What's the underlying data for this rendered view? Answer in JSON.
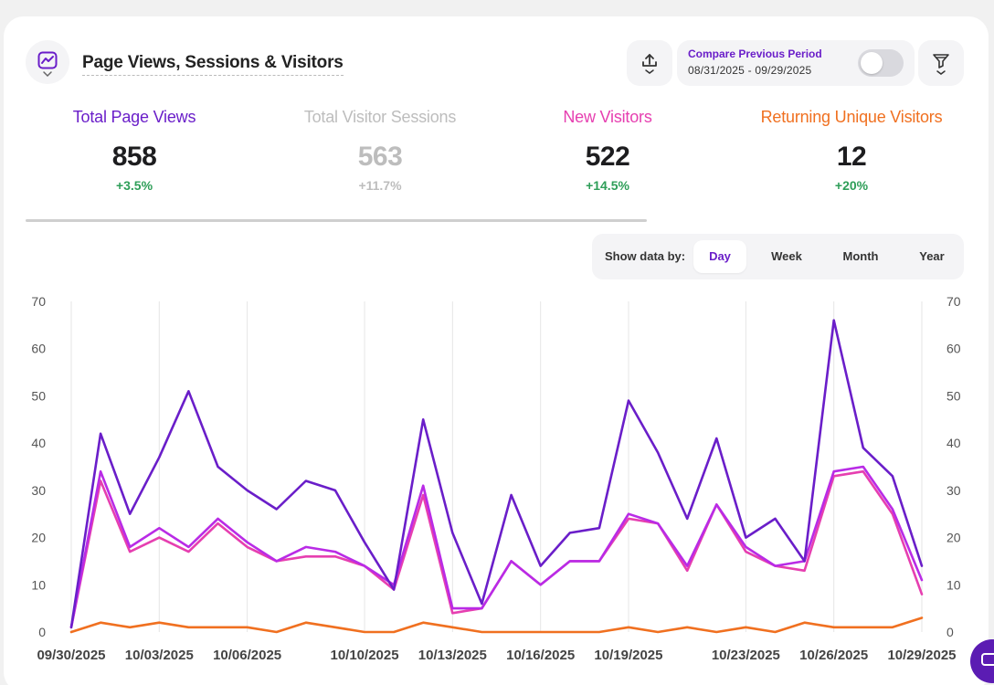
{
  "card": {
    "title": "Page Views, Sessions & Visitors",
    "icon": "chart-icon"
  },
  "compare": {
    "label": "Compare Previous Period",
    "range": "08/31/2025 - 09/29/2025",
    "enabled": false
  },
  "toolbar": {
    "export_icon": "upload-icon",
    "filter_icon": "filter-icon"
  },
  "metrics": [
    {
      "label": "Total Page Views",
      "value": "858",
      "change": "+3.5%",
      "color": "#6a1ec9"
    },
    {
      "label": "Total Visitor Sessions",
      "value": "563",
      "change": "+11.7%",
      "color": "#bdbdbd"
    },
    {
      "label": "New Visitors",
      "value": "522",
      "change": "+14.5%",
      "color": "#e63fb0"
    },
    {
      "label": "Returning Unique Visitors",
      "value": "12",
      "change": "+20%",
      "color": "#f07020"
    }
  ],
  "show_data": {
    "label": "Show data by:",
    "options": [
      "Day",
      "Week",
      "Month",
      "Year"
    ],
    "selected": "Day"
  },
  "colors": {
    "accent": "#6a1ec9",
    "positive": "#2e9e58"
  },
  "chart_data": {
    "type": "line",
    "x": [
      "09/30/2025",
      "10/01/2025",
      "10/02/2025",
      "10/03/2025",
      "10/04/2025",
      "10/05/2025",
      "10/06/2025",
      "10/07/2025",
      "10/08/2025",
      "10/09/2025",
      "10/10/2025",
      "10/11/2025",
      "10/12/2025",
      "10/13/2025",
      "10/14/2025",
      "10/15/2025",
      "10/16/2025",
      "10/17/2025",
      "10/18/2025",
      "10/19/2025",
      "10/20/2025",
      "10/21/2025",
      "10/22/2025",
      "10/23/2025",
      "10/24/2025",
      "10/25/2025",
      "10/26/2025",
      "10/27/2025",
      "10/28/2025",
      "10/29/2025"
    ],
    "tick_labels": [
      "09/30/2025",
      "10/03/2025",
      "10/06/2025",
      "10/10/2025",
      "10/13/2025",
      "10/16/2025",
      "10/19/2025",
      "10/23/2025",
      "10/26/2025",
      "10/29/2025"
    ],
    "tick_indices": [
      0,
      3,
      6,
      10,
      13,
      16,
      19,
      23,
      26,
      29
    ],
    "yticks": [
      0,
      10,
      20,
      30,
      40,
      50,
      60,
      70
    ],
    "ylim": [
      0,
      70
    ],
    "grid": true,
    "series": [
      {
        "name": "Total Page Views",
        "color": "#6a1ec9",
        "values": [
          1,
          42,
          25,
          37,
          51,
          35,
          30,
          26,
          32,
          30,
          19,
          9,
          45,
          21,
          6,
          29,
          14,
          21,
          22,
          49,
          38,
          24,
          41,
          20,
          24,
          15,
          66,
          39,
          33,
          14
        ]
      },
      {
        "name": "Total Visitor Sessions",
        "color": "#b92be6",
        "values": [
          1,
          34,
          18,
          22,
          18,
          24,
          19,
          15,
          18,
          17,
          14,
          10,
          31,
          5,
          5,
          15,
          10,
          15,
          15,
          25,
          23,
          14,
          27,
          18,
          14,
          15,
          34,
          35,
          26,
          11
        ]
      },
      {
        "name": "New Visitors",
        "color": "#e63fb0",
        "values": [
          1,
          32,
          17,
          20,
          17,
          23,
          18,
          15,
          16,
          16,
          14,
          9,
          29,
          4,
          5,
          15,
          10,
          15,
          15,
          24,
          23,
          13,
          27,
          17,
          14,
          13,
          33,
          34,
          25,
          8
        ]
      },
      {
        "name": "Returning Unique Visitors",
        "color": "#f07020",
        "values": [
          0,
          2,
          1,
          2,
          1,
          1,
          1,
          0,
          2,
          1,
          0,
          0,
          2,
          1,
          0,
          0,
          0,
          0,
          0,
          1,
          0,
          1,
          0,
          1,
          0,
          2,
          1,
          1,
          1,
          3
        ]
      }
    ]
  }
}
